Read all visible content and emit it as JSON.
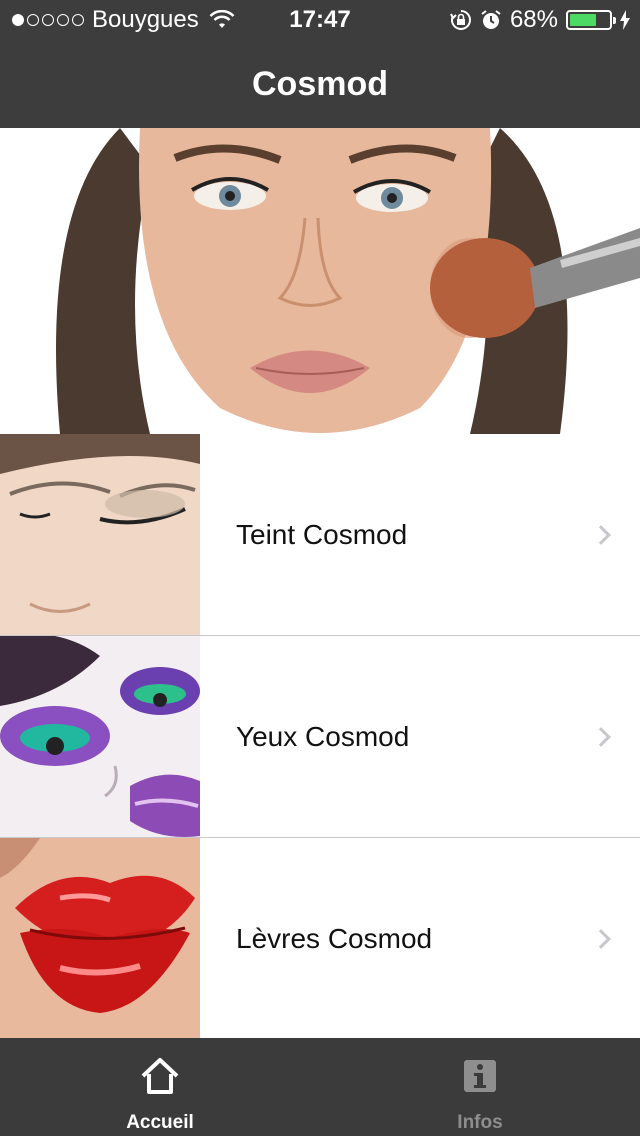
{
  "status_bar": {
    "carrier": "Bouygues",
    "time": "17:47",
    "battery": "68%",
    "battery_level": 0.68,
    "signal_bars_filled": 1,
    "signal_bars_total": 5
  },
  "nav": {
    "title": "Cosmod"
  },
  "menu": {
    "items": [
      {
        "label": "Teint Cosmod"
      },
      {
        "label": "Yeux Cosmod"
      },
      {
        "label": "Lèvres Cosmod"
      }
    ]
  },
  "tab_bar": {
    "tabs": [
      {
        "label": "Accueil",
        "icon": "home-icon",
        "active": true
      },
      {
        "label": "Infos",
        "icon": "info-icon",
        "active": false
      }
    ]
  },
  "colors": {
    "bar_background": "#3d3d3d",
    "battery_green": "#4cd964",
    "chevron": "#c7c7cc",
    "separator": "#c8c8cc"
  }
}
